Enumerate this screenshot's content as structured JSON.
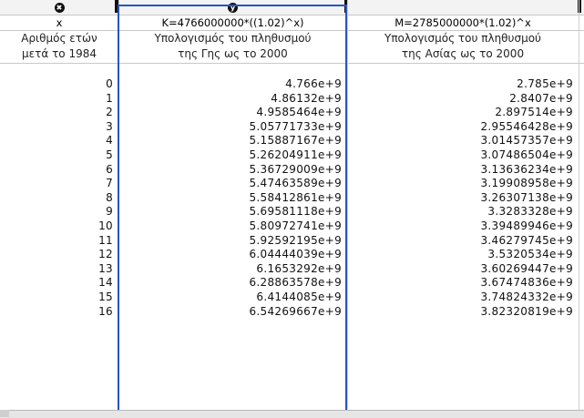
{
  "columns": {
    "x": {
      "icon": "x-circle-icon",
      "icon_glyph": "✖",
      "formula": "x",
      "label_line1": "Αριθμός ετών",
      "label_line2": "μετά το 1984"
    },
    "k": {
      "icon": "y-circle-icon",
      "icon_glyph": "y",
      "formula": "K=4766000000*((1.02)^x)",
      "label_line1": "Υπολογισμός του πληθυσμού",
      "label_line2": "της Γης ως το 2000"
    },
    "m": {
      "formula": "M=2785000000*(1.02)^x",
      "label_line1": "Υπολογισμός του πληθυσμού",
      "label_line2": "της Ασίας ως το 2000"
    }
  },
  "rows": [
    {
      "x": "0",
      "k": "4.766e+9",
      "m": "2.785e+9"
    },
    {
      "x": "1",
      "k": "4.86132e+9",
      "m": "2.8407e+9"
    },
    {
      "x": "2",
      "k": "4.9585464e+9",
      "m": "2.897514e+9"
    },
    {
      "x": "3",
      "k": "5.05771733e+9",
      "m": "2.95546428e+9"
    },
    {
      "x": "4",
      "k": "5.15887167e+9",
      "m": "3.01457357e+9"
    },
    {
      "x": "5",
      "k": "5.26204911e+9",
      "m": "3.07486504e+9"
    },
    {
      "x": "6",
      "k": "5.36729009e+9",
      "m": "3.13636234e+9"
    },
    {
      "x": "7",
      "k": "5.47463589e+9",
      "m": "3.19908958e+9"
    },
    {
      "x": "8",
      "k": "5.58412861e+9",
      "m": "3.26307138e+9"
    },
    {
      "x": "9",
      "k": "5.69581118e+9",
      "m": "3.3283328e+9"
    },
    {
      "x": "10",
      "k": "5.80972741e+9",
      "m": "3.39489946e+9"
    },
    {
      "x": "11",
      "k": "5.92592195e+9",
      "m": "3.46279745e+9"
    },
    {
      "x": "12",
      "k": "6.04444039e+9",
      "m": "3.5320534e+9"
    },
    {
      "x": "13",
      "k": "6.1653292e+9",
      "m": "3.60269447e+9"
    },
    {
      "x": "14",
      "k": "6.28863578e+9",
      "m": "3.67474836e+9"
    },
    {
      "x": "15",
      "k": "6.4144085e+9",
      "m": "3.74824332e+9"
    },
    {
      "x": "16",
      "k": "6.54269667e+9",
      "m": "3.82320819e+9"
    }
  ],
  "colors": {
    "selection": "#2a54c4",
    "header_bg": "#f3f3f3"
  }
}
